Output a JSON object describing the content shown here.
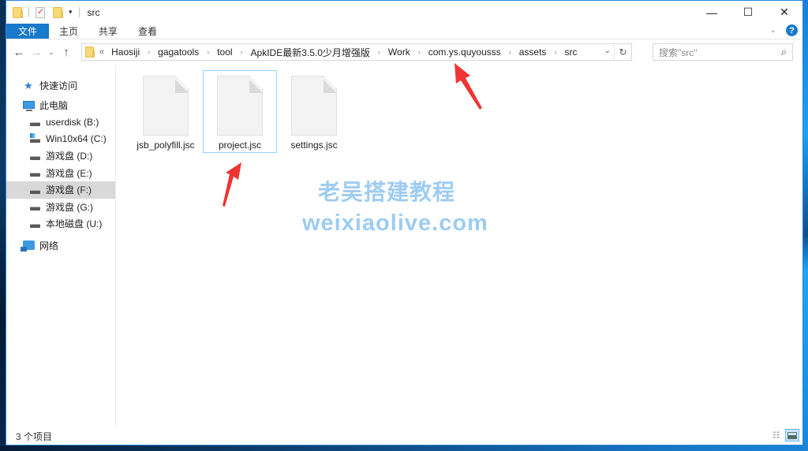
{
  "window": {
    "title": "src",
    "controls": {
      "minimize": "—",
      "maximize": "☐",
      "close": "✕"
    }
  },
  "quick_access_toolbar": {
    "icons": [
      "folder-icon",
      "properties-icon",
      "new-folder-icon"
    ],
    "dropdown": "▾"
  },
  "ribbon": {
    "tabs": [
      {
        "label": "文件",
        "active": true
      },
      {
        "label": "主页"
      },
      {
        "label": "共享"
      },
      {
        "label": "查看"
      }
    ],
    "expand_icon": "⌄",
    "help_icon": "?"
  },
  "navigation": {
    "back": "←",
    "forward": "→",
    "recent": "⌄",
    "up": "↑"
  },
  "address_bar": {
    "overflow": "«",
    "separator": "›",
    "breadcrumbs": [
      "Haosiji",
      "gagatools",
      "tool",
      "ApkIDE最新3.5.0少月增强版",
      "Work",
      "com.ys.quyousss",
      "assets",
      "src"
    ],
    "dropdown": "⌄",
    "refresh": "↻"
  },
  "search": {
    "placeholder": "搜索\"src\"",
    "icon": "⚲"
  },
  "nav_pane": {
    "quick_access": "快速访问",
    "this_pc": "此电脑",
    "drives": [
      {
        "label": "userdisk (B:)",
        "type": "drive"
      },
      {
        "label": "Win10x64 (C:)",
        "type": "os"
      },
      {
        "label": "游戏盘 (D:)",
        "type": "drive"
      },
      {
        "label": "游戏盘 (E:)",
        "type": "drive"
      },
      {
        "label": "游戏盘 (F:)",
        "type": "drive",
        "selected": true
      },
      {
        "label": "游戏盘 (G:)",
        "type": "drive"
      },
      {
        "label": "本地磁盘 (U:)",
        "type": "drive"
      }
    ],
    "network": "网络"
  },
  "files": [
    {
      "name": "jsb_polyfill.jsc",
      "selected": false
    },
    {
      "name": "project.jsc",
      "selected": true
    },
    {
      "name": "settings.jsc",
      "selected": false
    }
  ],
  "watermark": {
    "line1": "老吴搭建教程",
    "line2": "weixiaolive.com"
  },
  "annotations": {
    "arrow_color": "#f03434",
    "targets": [
      "com.ys.quyousss",
      "project.jsc"
    ]
  },
  "status_bar": {
    "item_count": "3 个项目"
  },
  "colors": {
    "accent": "#1979ca",
    "selection": "#99d1ff",
    "nav_selected": "#d9d9d9",
    "watermark": "#8cc4f0"
  }
}
